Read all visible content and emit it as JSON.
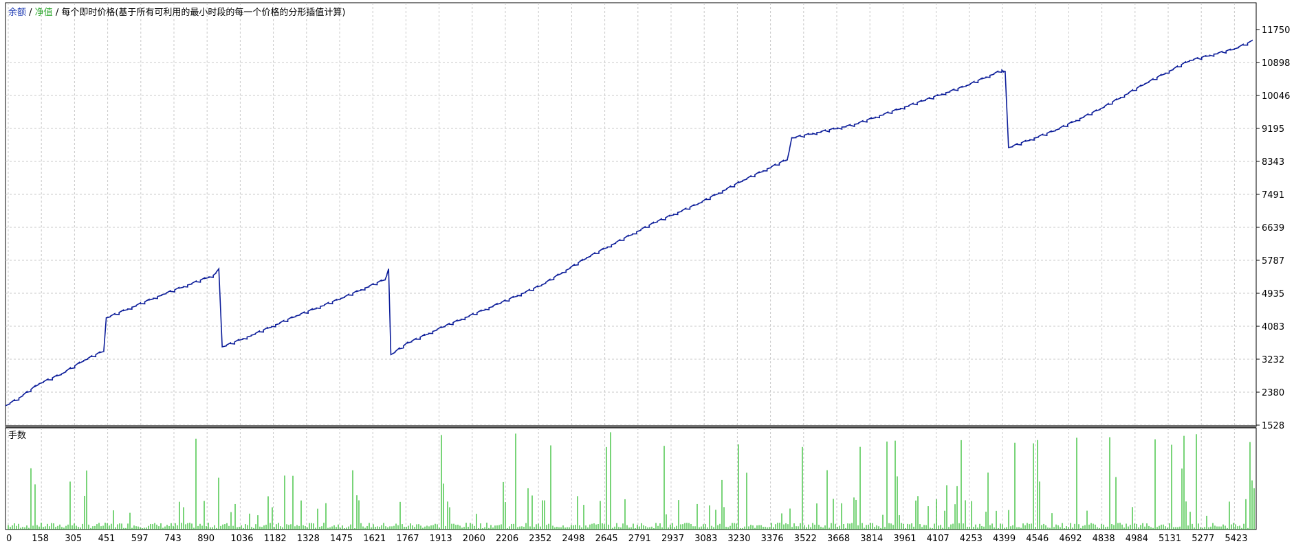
{
  "legend": {
    "balance": "余额",
    "sep1": " / ",
    "equity": "净值",
    "sep2": " / ",
    "mode": "每个即时价格(基于所有可利用的最小时段的每一个价格的分形插值计算)"
  },
  "lots_panel_label": "手数",
  "colors": {
    "balance_line": "#0b1c99",
    "volume_bars": "#1fb81f",
    "grid": "#c8c8c8",
    "frame": "#000000",
    "separator": "#707070"
  },
  "chart_data": [
    {
      "type": "line",
      "series": [
        {
          "name": "余额",
          "x": [
            0,
            60,
            150,
            250,
            350,
            440,
            451,
            700,
            930,
            955,
            970,
            1100,
            1300,
            1500,
            1700,
            1715,
            1725,
            1800,
            1950,
            2200,
            2400,
            2600,
            2900,
            3100,
            3300,
            3500,
            3520,
            3800,
            4100,
            4300,
            4460,
            4475,
            4490,
            4700,
            4900,
            5100,
            5300,
            5500,
            5580
          ],
          "values": [
            2030,
            2230,
            2600,
            2850,
            3200,
            3450,
            4300,
            4900,
            5400,
            5550,
            3550,
            3850,
            4350,
            4800,
            5300,
            5550,
            3350,
            3650,
            4050,
            4650,
            5150,
            5850,
            6750,
            7250,
            7850,
            8400,
            8950,
            9300,
            9900,
            10300,
            10700,
            10650,
            8700,
            9150,
            9700,
            10350,
            10950,
            11250,
            11450
          ]
        }
      ],
      "y_ticks": [
        "11750",
        "10898",
        "10046",
        "9195",
        "8343",
        "7491",
        "6639",
        "5787",
        "4935",
        "4083",
        "3232",
        "2380",
        "1528"
      ],
      "ylim": [
        1528,
        11750
      ],
      "x_ticks": [
        "0",
        "158",
        "305",
        "451",
        "597",
        "743",
        "890",
        "1036",
        "1182",
        "1328",
        "1475",
        "1621",
        "1767",
        "1913",
        "2060",
        "2206",
        "2352",
        "2498",
        "2645",
        "2791",
        "2937",
        "3083",
        "3230",
        "3376",
        "3522",
        "3668",
        "3814",
        "3961",
        "4107",
        "4253",
        "4399",
        "4546",
        "4692",
        "4838",
        "4984",
        "5131",
        "5277",
        "5423"
      ],
      "xlim": [
        0,
        5580
      ],
      "grid": true
    },
    {
      "type": "bar",
      "title": "手数",
      "description_of_values": "many thin spikes; relative heights",
      "series": [
        {
          "name": "手数",
          "x": [],
          "values": []
        }
      ]
    }
  ]
}
